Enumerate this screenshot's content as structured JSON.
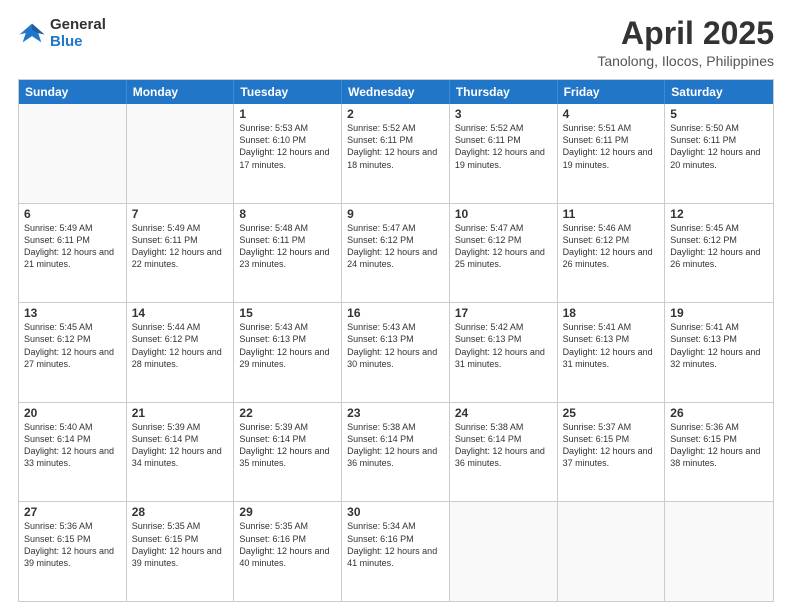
{
  "logo": {
    "line1": "General",
    "line2": "Blue"
  },
  "title": "April 2025",
  "subtitle": "Tanolong, Ilocos, Philippines",
  "days_of_week": [
    "Sunday",
    "Monday",
    "Tuesday",
    "Wednesday",
    "Thursday",
    "Friday",
    "Saturday"
  ],
  "weeks": [
    [
      {
        "day": "",
        "empty": true
      },
      {
        "day": "",
        "empty": true
      },
      {
        "day": "1",
        "rise": "5:53 AM",
        "set": "6:10 PM",
        "daylight": "12 hours and 17 minutes."
      },
      {
        "day": "2",
        "rise": "5:52 AM",
        "set": "6:11 PM",
        "daylight": "12 hours and 18 minutes."
      },
      {
        "day": "3",
        "rise": "5:52 AM",
        "set": "6:11 PM",
        "daylight": "12 hours and 19 minutes."
      },
      {
        "day": "4",
        "rise": "5:51 AM",
        "set": "6:11 PM",
        "daylight": "12 hours and 19 minutes."
      },
      {
        "day": "5",
        "rise": "5:50 AM",
        "set": "6:11 PM",
        "daylight": "12 hours and 20 minutes."
      }
    ],
    [
      {
        "day": "6",
        "rise": "5:49 AM",
        "set": "6:11 PM",
        "daylight": "12 hours and 21 minutes."
      },
      {
        "day": "7",
        "rise": "5:49 AM",
        "set": "6:11 PM",
        "daylight": "12 hours and 22 minutes."
      },
      {
        "day": "8",
        "rise": "5:48 AM",
        "set": "6:11 PM",
        "daylight": "12 hours and 23 minutes."
      },
      {
        "day": "9",
        "rise": "5:47 AM",
        "set": "6:12 PM",
        "daylight": "12 hours and 24 minutes."
      },
      {
        "day": "10",
        "rise": "5:47 AM",
        "set": "6:12 PM",
        "daylight": "12 hours and 25 minutes."
      },
      {
        "day": "11",
        "rise": "5:46 AM",
        "set": "6:12 PM",
        "daylight": "12 hours and 26 minutes."
      },
      {
        "day": "12",
        "rise": "5:45 AM",
        "set": "6:12 PM",
        "daylight": "12 hours and 26 minutes."
      }
    ],
    [
      {
        "day": "13",
        "rise": "5:45 AM",
        "set": "6:12 PM",
        "daylight": "12 hours and 27 minutes."
      },
      {
        "day": "14",
        "rise": "5:44 AM",
        "set": "6:12 PM",
        "daylight": "12 hours and 28 minutes."
      },
      {
        "day": "15",
        "rise": "5:43 AM",
        "set": "6:13 PM",
        "daylight": "12 hours and 29 minutes."
      },
      {
        "day": "16",
        "rise": "5:43 AM",
        "set": "6:13 PM",
        "daylight": "12 hours and 30 minutes."
      },
      {
        "day": "17",
        "rise": "5:42 AM",
        "set": "6:13 PM",
        "daylight": "12 hours and 31 minutes."
      },
      {
        "day": "18",
        "rise": "5:41 AM",
        "set": "6:13 PM",
        "daylight": "12 hours and 31 minutes."
      },
      {
        "day": "19",
        "rise": "5:41 AM",
        "set": "6:13 PM",
        "daylight": "12 hours and 32 minutes."
      }
    ],
    [
      {
        "day": "20",
        "rise": "5:40 AM",
        "set": "6:14 PM",
        "daylight": "12 hours and 33 minutes."
      },
      {
        "day": "21",
        "rise": "5:39 AM",
        "set": "6:14 PM",
        "daylight": "12 hours and 34 minutes."
      },
      {
        "day": "22",
        "rise": "5:39 AM",
        "set": "6:14 PM",
        "daylight": "12 hours and 35 minutes."
      },
      {
        "day": "23",
        "rise": "5:38 AM",
        "set": "6:14 PM",
        "daylight": "12 hours and 36 minutes."
      },
      {
        "day": "24",
        "rise": "5:38 AM",
        "set": "6:14 PM",
        "daylight": "12 hours and 36 minutes."
      },
      {
        "day": "25",
        "rise": "5:37 AM",
        "set": "6:15 PM",
        "daylight": "12 hours and 37 minutes."
      },
      {
        "day": "26",
        "rise": "5:36 AM",
        "set": "6:15 PM",
        "daylight": "12 hours and 38 minutes."
      }
    ],
    [
      {
        "day": "27",
        "rise": "5:36 AM",
        "set": "6:15 PM",
        "daylight": "12 hours and 39 minutes."
      },
      {
        "day": "28",
        "rise": "5:35 AM",
        "set": "6:15 PM",
        "daylight": "12 hours and 39 minutes."
      },
      {
        "day": "29",
        "rise": "5:35 AM",
        "set": "6:16 PM",
        "daylight": "12 hours and 40 minutes."
      },
      {
        "day": "30",
        "rise": "5:34 AM",
        "set": "6:16 PM",
        "daylight": "12 hours and 41 minutes."
      },
      {
        "day": "",
        "empty": true
      },
      {
        "day": "",
        "empty": true
      },
      {
        "day": "",
        "empty": true
      }
    ]
  ]
}
